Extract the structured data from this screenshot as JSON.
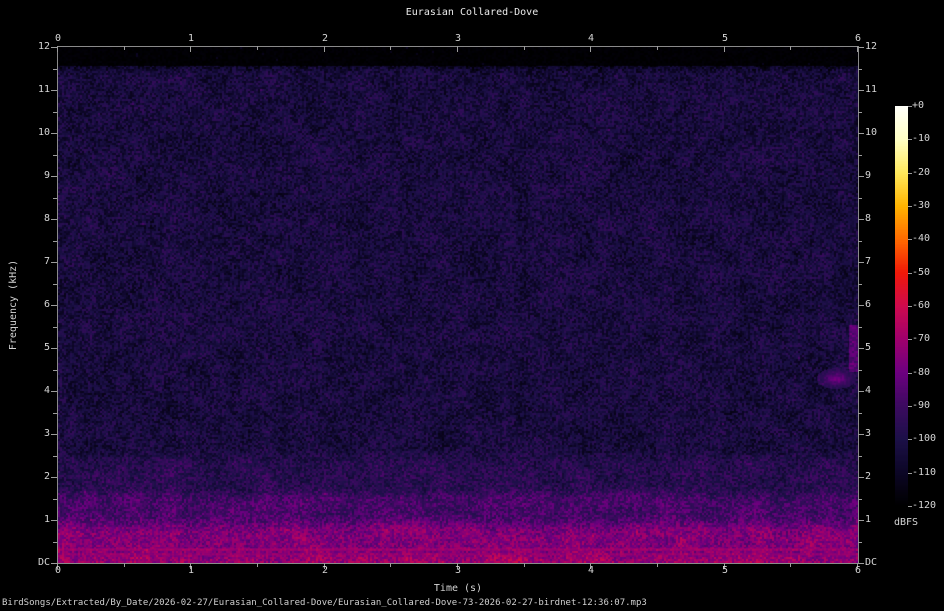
{
  "title": "Eurasian Collared-Dove",
  "footer": "BirdSongs/Extracted/By_Date/2026-02-27/Eurasian_Collared-Dove/Eurasian_Collared-Dove-73-2026-02-27-birdnet-12:36:07.mp3",
  "x_axis": {
    "label": "Time (s)",
    "ticks": [
      "0",
      "1",
      "2",
      "3",
      "4",
      "5",
      "6"
    ]
  },
  "y_axis": {
    "label": "Frequency (kHz)",
    "ticks": [
      "12",
      "11",
      "10",
      "9",
      "8",
      "7",
      "6",
      "5",
      "4",
      "3",
      "2",
      "1",
      "DC"
    ]
  },
  "colorbar": {
    "unit": "dBFS",
    "ticks": [
      "+0",
      "-10",
      "-20",
      "-30",
      "-40",
      "-50",
      "-60",
      "-70",
      "-80",
      "-90",
      "-100",
      "-110",
      "-120"
    ]
  },
  "colors": {
    "background": "#000000",
    "label_text": "#d6d6d6",
    "title_text": "#eaeaea",
    "axis_line": "#8a8a8a",
    "tick_mark": "#9c9c9c"
  },
  "chart_data": {
    "type": "heatmap",
    "subtype": "audio-spectrogram",
    "title": "Eurasian Collared-Dove",
    "xlabel": "Time (s)",
    "ylabel": "Frequency (kHz)",
    "x_range_s": [
      0,
      6
    ],
    "y_range_khz": [
      0,
      12
    ],
    "colorbar_label": "dBFS",
    "colorbar_range_db": [
      -120,
      0
    ],
    "legend_position": "right",
    "grid": false,
    "palette_stops_db_to_color": [
      [
        -120,
        "#000000"
      ],
      [
        -110,
        "#0c0626"
      ],
      [
        -100,
        "#1c1048"
      ],
      [
        -90,
        "#3c0a60"
      ],
      [
        -80,
        "#6d0080"
      ],
      [
        -70,
        "#a0006c"
      ],
      [
        -60,
        "#cf0a4e"
      ],
      [
        -50,
        "#f01808"
      ],
      [
        -40,
        "#ff6a00"
      ],
      [
        -30,
        "#ffb400"
      ],
      [
        -20,
        "#ffe95c"
      ],
      [
        -10,
        "#ffffc4"
      ],
      [
        0,
        "#fffffa"
      ]
    ],
    "bands_db": [
      {
        "freq_khz": [
          11.55,
          12.0
        ],
        "level_db": -119,
        "note": "codec high-frequency cutoff (black)"
      },
      {
        "freq_khz": [
          2.5,
          11.55
        ],
        "level_db": -103,
        "note": "broadband background noise (dark blue-purple)"
      },
      {
        "freq_khz": [
          1.6,
          2.5
        ],
        "level_db": -97,
        "note": "transition band"
      },
      {
        "freq_khz": [
          0.9,
          1.6
        ],
        "level_db": -88,
        "note": "purple noise band"
      },
      {
        "freq_khz": [
          0.12,
          0.9
        ],
        "level_db": -76,
        "note": "bright pink low-frequency energy"
      },
      {
        "freq_khz": [
          0.0,
          0.12
        ],
        "level_db": -66,
        "note": "very bright band at DC"
      }
    ],
    "features": [
      {
        "time_s": [
          0.0,
          6.0
        ],
        "freq_khz": 0.32,
        "level_db": -70,
        "note": "persistent narrow line"
      },
      {
        "time_s": [
          0.0,
          6.0
        ],
        "freq_khz": 0.21,
        "level_db": -72,
        "note": "persistent narrow line"
      },
      {
        "time_s": [
          1.15,
          1.5
        ],
        "freq_khz": 0.56,
        "level_db": -77,
        "note": "faint dove coo trace"
      },
      {
        "time_s": [
          1.75,
          2.05
        ],
        "freq_khz": 0.5,
        "level_db": -78,
        "note": "faint trace"
      },
      {
        "time_s": [
          2.9,
          3.35
        ],
        "freq_khz": 0.6,
        "level_db": -77,
        "note": "faint trace"
      },
      {
        "time_s": [
          4.0,
          4.4
        ],
        "freq_khz": 0.5,
        "level_db": -79,
        "note": "faint trace"
      },
      {
        "time_s": [
          5.5,
          5.95
        ],
        "freq_khz": 0.55,
        "level_db": -76,
        "note": "faint trace"
      },
      {
        "time_s": [
          5.75,
          5.92
        ],
        "freq_khz": 4.3,
        "level_db": -80,
        "note": "faint pink blob",
        "shape": "blob"
      },
      {
        "time_s": [
          5.93,
          6.0
        ],
        "freq_khz": 5.0,
        "level_db": -84,
        "note": "pink streak at right edge",
        "shape": "edge-streak"
      }
    ],
    "noise_amplitude_db": 9
  }
}
